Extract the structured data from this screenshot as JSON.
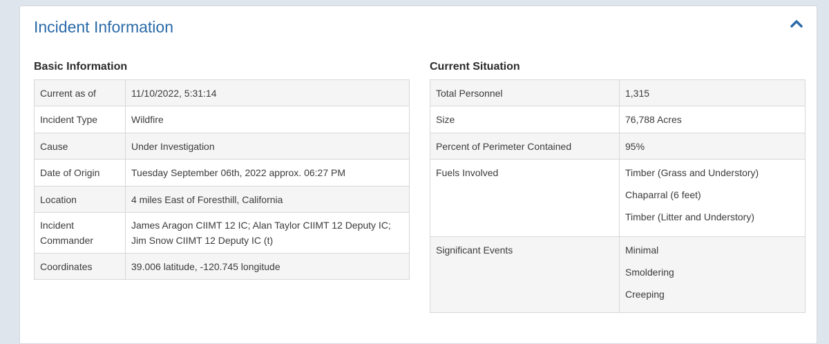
{
  "panel": {
    "title": "Incident Information",
    "collapse_icon": "chevron-up-icon",
    "accent_color": "#2a6aa8"
  },
  "basic": {
    "title": "Basic Information",
    "rows": [
      {
        "label": "Current as of",
        "value": "11/10/2022, 5:31:14"
      },
      {
        "label": "Incident Type",
        "value": "Wildfire"
      },
      {
        "label": "Cause",
        "value": "Under Investigation"
      },
      {
        "label": "Date of Origin",
        "value": "Tuesday September 06th, 2022 approx. 06:27 PM"
      },
      {
        "label": "Location",
        "value": "4 miles East of Foresthill, California"
      },
      {
        "label_line1": "Incident",
        "label_line2": "Commander",
        "value": "James Aragon CIIMT 12 IC; Alan Taylor CIIMT 12 Deputy IC; Jim Snow CIIMT 12 Deputy IC (t)"
      },
      {
        "label": "Coordinates",
        "value": "39.006 latitude, -120.745 longitude"
      }
    ]
  },
  "situation": {
    "title": "Current Situation",
    "rows": [
      {
        "label": "Total Personnel",
        "value": "1,315"
      },
      {
        "label": "Size",
        "value": "76,788 Acres"
      },
      {
        "label": "Percent of Perimeter Contained",
        "value": "95%"
      },
      {
        "label": "Fuels Involved",
        "values": [
          "Timber (Grass and Understory)",
          "Chaparral (6 feet)",
          "Timber (Litter and Understory)"
        ]
      },
      {
        "label": "Significant Events",
        "values": [
          "Minimal",
          "Smoldering",
          "Creeping"
        ]
      }
    ]
  }
}
